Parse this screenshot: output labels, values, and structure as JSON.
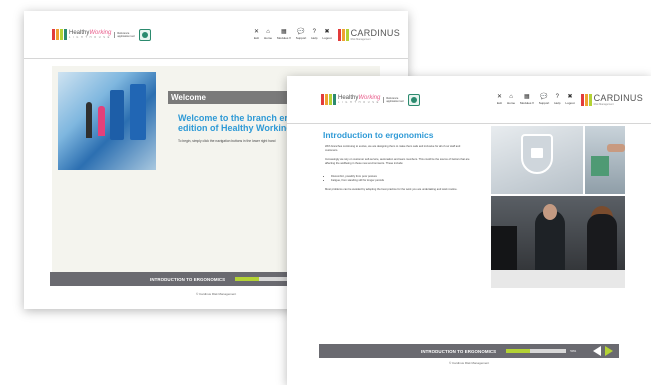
{
  "brand": {
    "name_main": "Healthy",
    "name_accent": "Working",
    "name_sub": "L I G H T H O U S E",
    "tagline": "Reference application tool",
    "client": "CARDINUS",
    "client_sub": "Risk Management",
    "bar_colors": [
      "#e23b3b",
      "#f0a030",
      "#b3d235",
      "#2b8a6e"
    ]
  },
  "nav": [
    {
      "label": "Exit",
      "icon": "✕"
    },
    {
      "label": "Home",
      "icon": "⌂"
    },
    {
      "label": "Modules ▾",
      "icon": "▦"
    },
    {
      "label": "Support",
      "icon": "💬"
    },
    {
      "label": "Help",
      "icon": "?"
    },
    {
      "label": "Logout",
      "icon": "✖"
    }
  ],
  "back_screen": {
    "welcome_heading": "Welcome",
    "welcome_title_line1": "Welcome to the branch erg",
    "welcome_title_line2": "edition of Healthy Working",
    "welcome_sub": "To begin, simply click the navigation buttons in the lower right hand",
    "module_title": "INTRODUCTION TO ERGONOMICS",
    "copyright": "© Cardinus Risk Management"
  },
  "front_screen": {
    "title": "Introduction to ergonomics",
    "para1": "With branches continuing to evolve, we are designing them to make them safe and inclusive for all of our staff and customers.",
    "para2": "Increasingly we rely on customer self-service, automation and team members. This could be the source of factors that are affecting the wellbeing in these new environments. These include:",
    "bullets": [
      "Discomfort, possibly from poor posture",
      "Fatigue, from standing still for longer periods"
    ],
    "para3": "Most problems can be avoided by adopting the best practice for the work you are undertaking and work routine.",
    "module_title": "INTRODUCTION TO ERGONOMICS",
    "progress_pct": "50%",
    "progress_fraction": 0.4,
    "copyright": "© Cardinus Risk Management"
  }
}
